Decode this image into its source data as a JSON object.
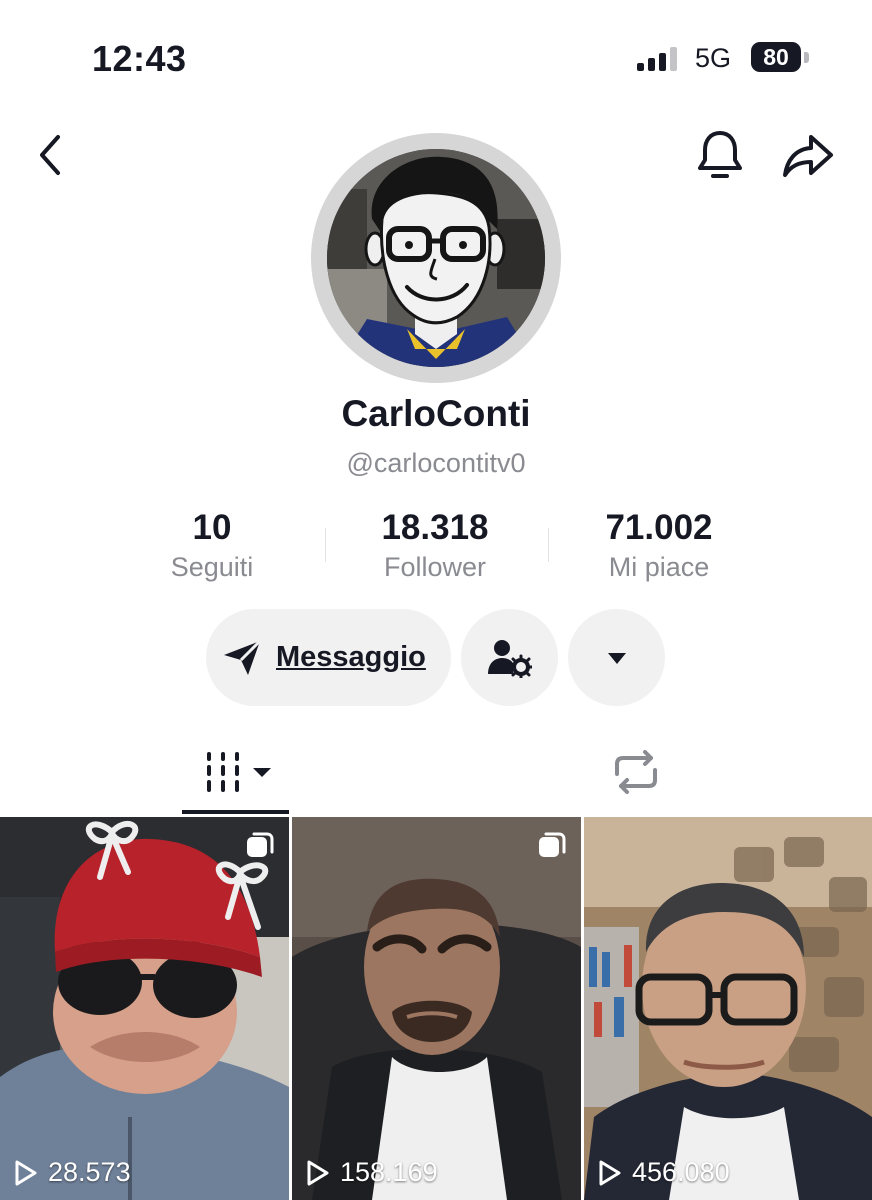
{
  "status_bar": {
    "time": "12:43",
    "network": "5G",
    "battery": "80"
  },
  "profile": {
    "display_name": "CarloConti",
    "username": "@carlocontitv0",
    "stats": [
      {
        "value": "10",
        "label": "Seguiti"
      },
      {
        "value": "18.318",
        "label": "Follower"
      },
      {
        "value": "71.002",
        "label": "Mi piace"
      }
    ]
  },
  "actions": {
    "message_label": "Messaggio"
  },
  "icons": {
    "back": "chevron-left-icon",
    "bell": "bell-icon",
    "share": "share-arrow-icon",
    "send": "send-icon",
    "user_settings": "user-gear-icon",
    "more": "caret-down-icon",
    "videos_tab": "grid-icon",
    "reposts_tab": "repost-icon"
  },
  "videos": [
    {
      "views": "28.573"
    },
    {
      "views": "158.169"
    },
    {
      "views": "456.080"
    }
  ]
}
